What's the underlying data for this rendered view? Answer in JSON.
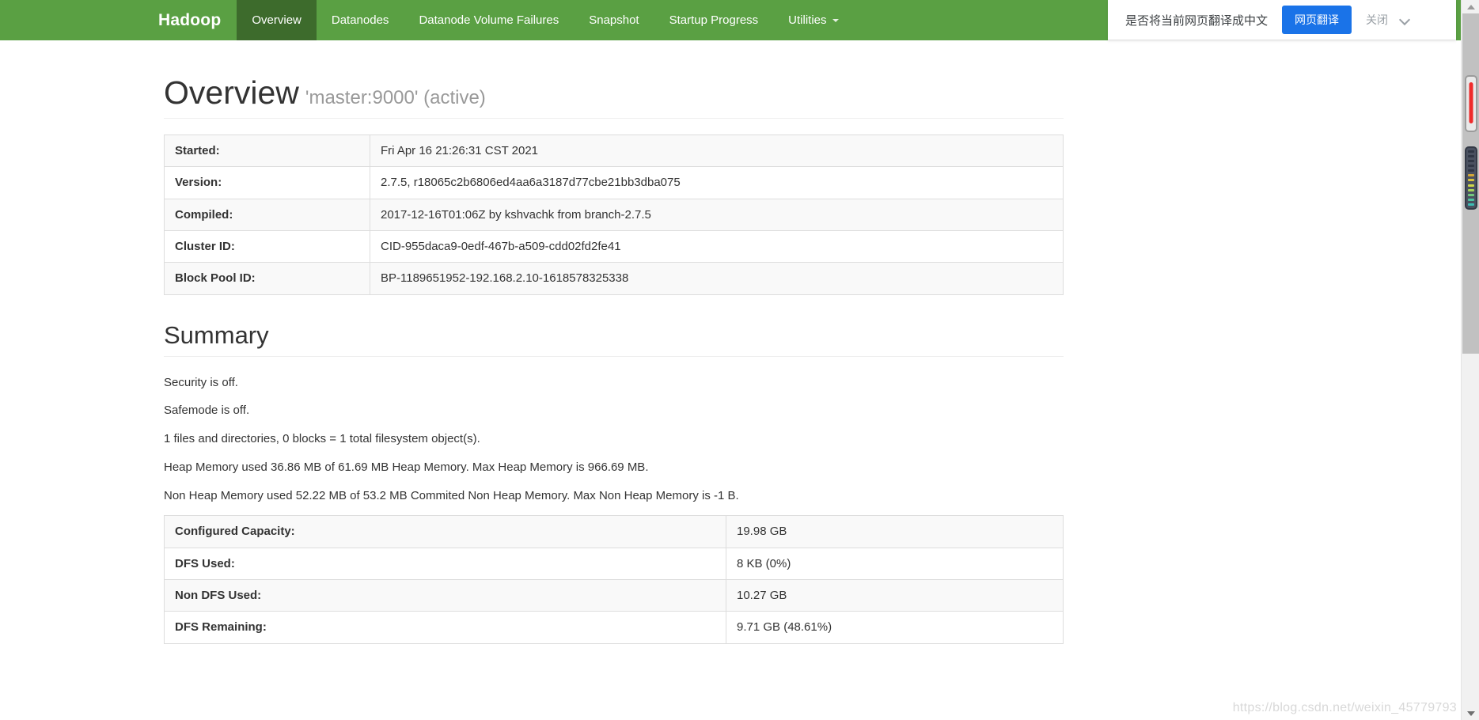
{
  "navbar": {
    "brand": "Hadoop",
    "items": [
      {
        "label": "Overview",
        "active": true
      },
      {
        "label": "Datanodes",
        "active": false
      },
      {
        "label": "Datanode Volume Failures",
        "active": false
      },
      {
        "label": "Snapshot",
        "active": false
      },
      {
        "label": "Startup Progress",
        "active": false
      },
      {
        "label": "Utilities",
        "active": false,
        "caret": true
      }
    ],
    "background_color": "#5aa043",
    "active_color": "#3d6b2c"
  },
  "translate_bar": {
    "message": "是否将当前网页翻译成中文",
    "primary_button": "网页翻译",
    "close_label": "关闭",
    "chevron_icon": "chevron-down-icon",
    "button_color": "#1a73e8"
  },
  "overview": {
    "title": "Overview",
    "subtitle": "'master:9000' (active)",
    "rows": [
      {
        "key": "Started:",
        "value": "Fri Apr 16 21:26:31 CST 2021"
      },
      {
        "key": "Version:",
        "value": "2.7.5, r18065c2b6806ed4aa6a3187d77cbe21bb3dba075"
      },
      {
        "key": "Compiled:",
        "value": "2017-12-16T01:06Z by kshvachk from branch-2.7.5"
      },
      {
        "key": "Cluster ID:",
        "value": "CID-955daca9-0edf-467b-a509-cdd02fd2fe41"
      },
      {
        "key": "Block Pool ID:",
        "value": "BP-1189651952-192.168.2.10-1618578325338"
      }
    ]
  },
  "summary": {
    "title": "Summary",
    "lines": [
      "Security is off.",
      "Safemode is off.",
      "1 files and directories, 0 blocks = 1 total filesystem object(s).",
      "Heap Memory used 36.86 MB of 61.69 MB Heap Memory. Max Heap Memory is 966.69 MB.",
      "Non Heap Memory used 52.22 MB of 53.2 MB Commited Non Heap Memory. Max Non Heap Memory is -1 B."
    ],
    "capacity_rows": [
      {
        "key": "Configured Capacity:",
        "value": "19.98 GB"
      },
      {
        "key": "DFS Used:",
        "value": "8 KB (0%)"
      },
      {
        "key": "Non DFS Used:",
        "value": "10.27 GB"
      },
      {
        "key": "DFS Remaining:",
        "value": "9.71 GB (48.61%)"
      }
    ]
  },
  "scrollbar": {
    "up_arrow_icon": "scroll-up-arrow-icon",
    "down_arrow_icon": "scroll-down-arrow-icon"
  },
  "watermark": "https://blog.csdn.net/weixin_45779793"
}
